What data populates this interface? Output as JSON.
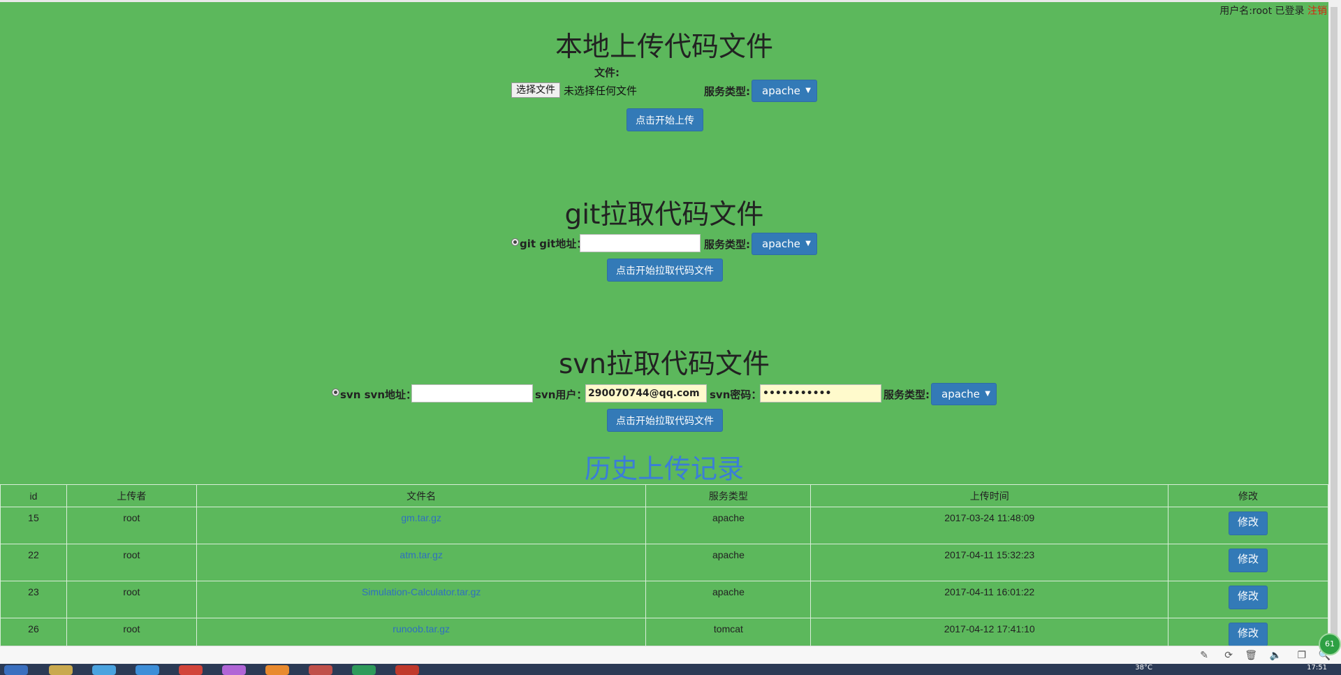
{
  "user": {
    "prefix": "用户名:root 已登录",
    "logout": "注销"
  },
  "local": {
    "title": "本地上传代码文件",
    "file_label": "文件:",
    "choose_btn": "选择文件",
    "no_file": "未选择任何文件",
    "service_label": "服务类型:",
    "service_value": "apache",
    "upload_btn": "点击开始上传"
  },
  "git": {
    "title": "git拉取代码文件",
    "addr_label": "git git地址：",
    "addr_value": "",
    "service_label": "服务类型:",
    "service_value": "apache",
    "pull_btn": "点击开始拉取代码文件"
  },
  "svn": {
    "title": "svn拉取代码文件",
    "addr_label": "svn svn地址：",
    "addr_value": "",
    "user_label": "svn用户：",
    "user_value": "290070744@qq.com",
    "pwd_label": "svn密码：",
    "pwd_value": "•••••••••••",
    "service_label": "服务类型:",
    "service_value": "apache",
    "pull_btn": "点击开始拉取代码文件"
  },
  "history": {
    "title": "历史上传记录",
    "columns": [
      "id",
      "上传者",
      "文件名",
      "服务类型",
      "上传时间",
      "修改"
    ],
    "rows": [
      {
        "id": "15",
        "uploader": "root",
        "file": "gm.tar.gz",
        "service": "apache",
        "time": "2017-03-24 11:48:09",
        "edit": "修改"
      },
      {
        "id": "22",
        "uploader": "root",
        "file": "atm.tar.gz",
        "service": "apache",
        "time": "2017-04-11 15:32:23",
        "edit": "修改"
      },
      {
        "id": "23",
        "uploader": "root",
        "file": "Simulation-Calculator.tar.gz",
        "service": "apache",
        "time": "2017-04-11 16:01:22",
        "edit": "修改"
      },
      {
        "id": "26",
        "uploader": "root",
        "file": "runoob.tar.gz",
        "service": "tomcat",
        "time": "2017-04-12 17:41:10",
        "edit": "修改"
      }
    ]
  },
  "taskbar": {
    "temp": "38°C",
    "clock": "17:51"
  },
  "badge": "61",
  "colors": {
    "page_bg": "#5cb85c",
    "button": "#337ab7",
    "link": "#2f6fc0",
    "logout": "#d9230f"
  }
}
